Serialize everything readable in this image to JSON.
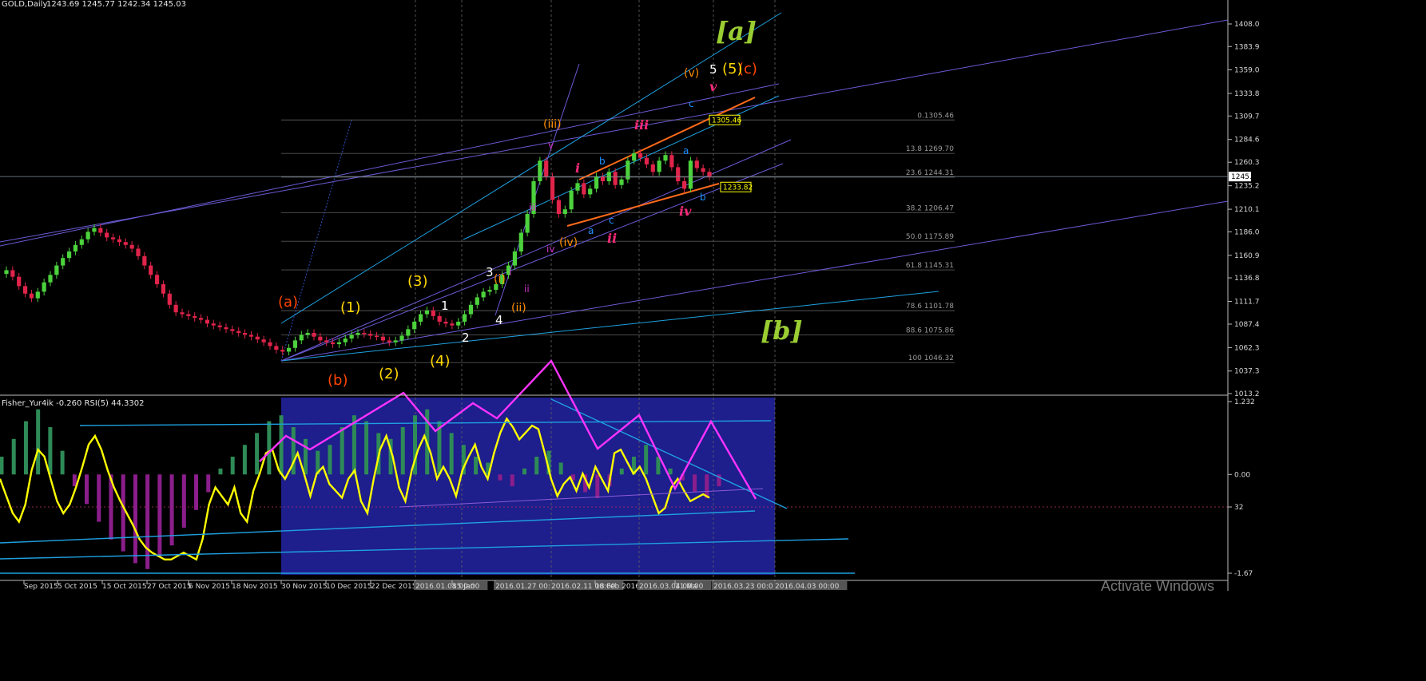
{
  "header": {
    "symbol": "GOLD,Daily",
    "ohlc": "1243.69 1245.77 1242.34 1245.03"
  },
  "indicator_header": "Fisher_Yur4ik -0.260  RSI(5) 44.3302",
  "watermark": "Activate Windows",
  "colors": {
    "background": "#000000",
    "bull_candle": "#4cd23c",
    "bear_candle": "#e0244a",
    "fib_line": "#555555",
    "rsi_line": "#ffff00",
    "fisher_pos": "#2e8b57",
    "fisher_neg": "#8b1e8b",
    "highlight_box": "#1e1e8c",
    "magenta_arrow": "#ff33ff"
  },
  "chart_data": [
    {
      "type": "candlestick",
      "title": "GOLD,Daily",
      "price_axis_ticks": [
        "1408.0",
        "1383.9",
        "1359.0",
        "1333.8",
        "1309.7",
        "1284.6",
        "1260.3",
        "1235.2",
        "1210.1",
        "1186.0",
        "1160.9",
        "1136.8",
        "1111.7",
        "1087.4",
        "1062.3",
        "1037.3",
        "1013.2"
      ],
      "ylim": [
        1013.2,
        1420
      ],
      "current_price": "1245.0",
      "time_axis_ticks": [
        "Sep 2015",
        "5 Oct 2015",
        "15 Oct 2015",
        "27 Oct 2015",
        "6 Nov 2015",
        "18 Nov 2015",
        "30 Nov 2015",
        "10 Dec 2015",
        "22 Dec 2015",
        "2016.01.08 00:00",
        "15 Jan",
        "2016.01.27 00:00",
        "2016.02.11 00:00",
        "18 Feb 2016",
        "2016.03.04 00:00",
        "11 Ma",
        "2016.03.23 00:00",
        "2016.04.03 00:00"
      ],
      "close_series": [
        1145,
        1138,
        1128,
        1120,
        1115,
        1122,
        1132,
        1140,
        1150,
        1158,
        1165,
        1172,
        1178,
        1186,
        1190,
        1185,
        1180,
        1178,
        1175,
        1172,
        1168,
        1160,
        1150,
        1140,
        1130,
        1120,
        1108,
        1100,
        1098,
        1096,
        1094,
        1092,
        1088,
        1086,
        1084,
        1082,
        1080,
        1078,
        1076,
        1074,
        1071,
        1068,
        1064,
        1060,
        1058,
        1062,
        1070,
        1076,
        1078,
        1074,
        1070,
        1068,
        1066,
        1068,
        1072,
        1076,
        1078,
        1077,
        1075,
        1074,
        1070,
        1068,
        1070,
        1075,
        1082,
        1090,
        1098,
        1102,
        1096,
        1090,
        1088,
        1086,
        1090,
        1098,
        1108,
        1116,
        1122,
        1124,
        1130,
        1140,
        1150,
        1165,
        1185,
        1205,
        1240,
        1262,
        1245,
        1220,
        1205,
        1210,
        1230,
        1238,
        1226,
        1232,
        1245,
        1240,
        1250,
        1236,
        1242,
        1262,
        1270,
        1265,
        1258,
        1250,
        1262,
        1268,
        1255,
        1240,
        1232,
        1262,
        1254,
        1250,
        1245
      ],
      "fib_levels": [
        {
          "label": "0.1305.46",
          "price": 1305.46
        },
        {
          "label": "13.8 1269.70",
          "price": 1269.7
        },
        {
          "label": "23.6 1244.31",
          "price": 1244.31
        },
        {
          "label": "38.2 1206.47",
          "price": 1206.47
        },
        {
          "label": "50.0 1175.89",
          "price": 1175.89
        },
        {
          "label": "61.8 1145.31",
          "price": 1145.31
        },
        {
          "label": "78.6 1101.78",
          "price": 1101.78
        },
        {
          "label": "88.6 1075.86",
          "price": 1075.86
        },
        {
          "label": "100 1046.32",
          "price": 1046.32
        }
      ],
      "price_boxes": [
        {
          "label": "1305.46",
          "price": 1305.46
        },
        {
          "label": "1233.82",
          "price": 1233.82
        }
      ],
      "wave_labels": [
        {
          "text": "[a]",
          "color": "#9acd32"
        },
        {
          "text": "[b]",
          "color": "#9acd32"
        },
        {
          "text": "(a)",
          "color": "#ff4500"
        },
        {
          "text": "(b)",
          "color": "#ff4500"
        },
        {
          "text": "(c)",
          "color": "#ff4500"
        },
        {
          "text": "(1)",
          "color": "#ffd700"
        },
        {
          "text": "(2)",
          "color": "#ffd700"
        },
        {
          "text": "(3)",
          "color": "#ffd700"
        },
        {
          "text": "(4)",
          "color": "#ffd700"
        },
        {
          "text": "(5)",
          "color": "#ffd700"
        },
        {
          "text": "1",
          "color": "#ffffff"
        },
        {
          "text": "2",
          "color": "#ffffff"
        },
        {
          "text": "3",
          "color": "#ffffff"
        },
        {
          "text": "4",
          "color": "#ffffff"
        },
        {
          "text": "5",
          "color": "#ffffff"
        },
        {
          "text": "(i)",
          "color": "#ff8c00"
        },
        {
          "text": "(ii)",
          "color": "#ff8c00"
        },
        {
          "text": "(iii)",
          "color": "#ff8c00"
        },
        {
          "text": "(iv)",
          "color": "#ff8c00"
        },
        {
          "text": "(v)",
          "color": "#ff8c00"
        },
        {
          "text": "i",
          "color": "#cc33cc"
        },
        {
          "text": "ii",
          "color": "#cc33cc"
        },
        {
          "text": "iii",
          "color": "#cc33cc"
        },
        {
          "text": "iv",
          "color": "#cc33cc"
        },
        {
          "text": "v",
          "color": "#cc33cc"
        },
        {
          "text": "i",
          "color": "#ff2a7a"
        },
        {
          "text": "ii",
          "color": "#ff2a7a"
        },
        {
          "text": "iii",
          "color": "#ff2a7a"
        },
        {
          "text": "iv",
          "color": "#ff2a7a"
        },
        {
          "text": "v",
          "color": "#ff2a7a"
        },
        {
          "text": "a",
          "color": "#1e90ff"
        },
        {
          "text": "b",
          "color": "#1e90ff"
        },
        {
          "text": "c",
          "color": "#1e90ff"
        },
        {
          "text": "a",
          "color": "#1e90ff"
        },
        {
          "text": "b",
          "color": "#1e90ff"
        },
        {
          "text": "c",
          "color": "#1e90ff"
        }
      ]
    },
    {
      "type": "line",
      "title": "Fisher_Yur4ik -0.260  RSI(5) 44.3302",
      "axis_ticks": [
        "1.232",
        "0.00",
        "32",
        "-1.67"
      ],
      "ylim": [
        -1.67,
        1.232
      ],
      "rsi_series": [
        55,
        45,
        35,
        30,
        40,
        60,
        72,
        68,
        55,
        42,
        35,
        40,
        50,
        62,
        75,
        80,
        72,
        60,
        50,
        42,
        35,
        28,
        20,
        15,
        12,
        10,
        8,
        8,
        10,
        12,
        10,
        8,
        20,
        40,
        50,
        45,
        40,
        50,
        35,
        30,
        48,
        58,
        70,
        72,
        60,
        55,
        62,
        70,
        58,
        45,
        58,
        62,
        52,
        48,
        44,
        55,
        60,
        42,
        35,
        55,
        72,
        80,
        68,
        50,
        42,
        60,
        72,
        80,
        70,
        55,
        62,
        55,
        45,
        60,
        68,
        75,
        62,
        55,
        70,
        82,
        90,
        85,
        78,
        82,
        86,
        84,
        70,
        55,
        45,
        52,
        56,
        48,
        58,
        50,
        62,
        55,
        48,
        70,
        72,
        65,
        58,
        62,
        55,
        45,
        35,
        38,
        50,
        55,
        48,
        42,
        44,
        46,
        44
      ],
      "fisher_hist": [
        0.3,
        0.6,
        0.9,
        1.1,
        0.8,
        0.4,
        -0.2,
        -0.5,
        -0.8,
        -1.1,
        -1.3,
        -1.5,
        -1.6,
        -1.4,
        -1.2,
        -0.9,
        -0.6,
        -0.3,
        0.1,
        0.3,
        0.5,
        0.7,
        0.9,
        1.0,
        0.8,
        0.6,
        0.4,
        0.5,
        0.8,
        1.0,
        0.9,
        0.7,
        0.6,
        0.8,
        1.0,
        1.1,
        0.9,
        0.7,
        0.5,
        0.3,
        0.2,
        -0.1,
        -0.2,
        0.1,
        0.3,
        0.4,
        0.2,
        -0.1,
        -0.3,
        -0.4,
        -0.2,
        0.1,
        0.3,
        0.5,
        0.3,
        0.1,
        -0.1,
        -0.3,
        -0.4,
        -0.2
      ]
    }
  ]
}
